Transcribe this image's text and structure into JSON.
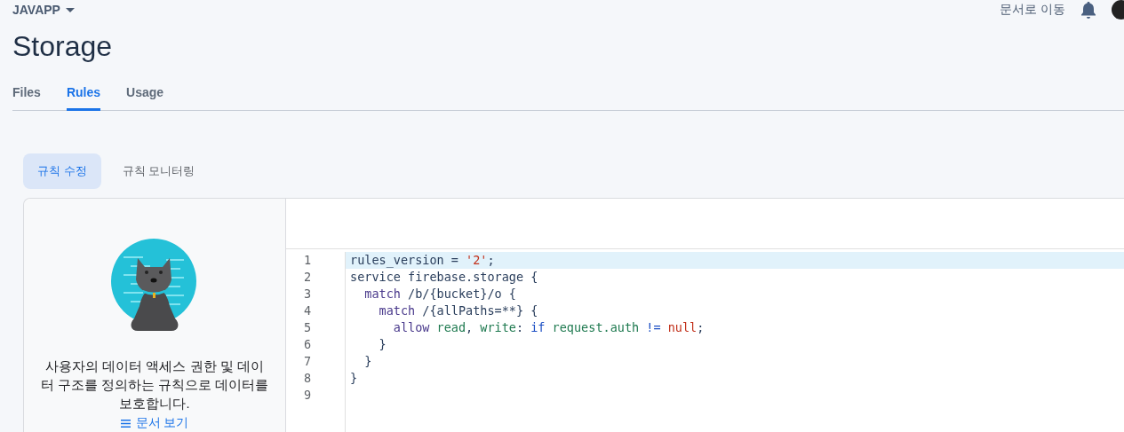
{
  "header": {
    "project": "JAVAPP",
    "docs_link": "문서로 이동"
  },
  "title": "Storage",
  "tabs": [
    {
      "label": "Files",
      "selected": false
    },
    {
      "label": "Rules",
      "selected": true
    },
    {
      "label": "Usage",
      "selected": false
    }
  ],
  "subtabs": [
    {
      "label": "규칙 수정",
      "selected": true
    },
    {
      "label": "규칙 모니터링",
      "selected": false
    }
  ],
  "info_panel": {
    "description": "사용자의 데이터 액세스 권한 및 데이터 구조를 정의하는 규칙으로 데이터를 보호합니다.",
    "docs_link": "문서 보기"
  },
  "editor": {
    "lines": [
      {
        "number": "1",
        "active": true,
        "tokens": [
          {
            "kind": "plain",
            "text": "rules_version = "
          },
          {
            "kind": "literal",
            "text": "'2'"
          },
          {
            "kind": "plain",
            "text": ";"
          }
        ]
      },
      {
        "number": "2",
        "active": false,
        "tokens": [
          {
            "kind": "plain",
            "text": "service firebase.storage {"
          }
        ]
      },
      {
        "number": "3",
        "active": false,
        "tokens": [
          {
            "kind": "keyword",
            "text": "  match"
          },
          {
            "kind": "plain",
            "text": " /b/{bucket}/o {"
          }
        ]
      },
      {
        "number": "4",
        "active": false,
        "tokens": [
          {
            "kind": "keyword",
            "text": "    match"
          },
          {
            "kind": "plain",
            "text": " /{allPaths=**} {"
          }
        ]
      },
      {
        "number": "5",
        "active": false,
        "tokens": [
          {
            "kind": "keyword",
            "text": "      allow"
          },
          {
            "kind": "ident",
            "text": " read"
          },
          {
            "kind": "plain",
            "text": ", "
          },
          {
            "kind": "ident",
            "text": "write"
          },
          {
            "kind": "plain",
            "text": ": "
          },
          {
            "kind": "operator",
            "text": "if"
          },
          {
            "kind": "ident",
            "text": " request.auth"
          },
          {
            "kind": "operator",
            "text": " !="
          },
          {
            "kind": "literal",
            "text": " null"
          },
          {
            "kind": "plain",
            "text": ";"
          }
        ]
      },
      {
        "number": "6",
        "active": false,
        "tokens": [
          {
            "kind": "plain",
            "text": "    }"
          }
        ]
      },
      {
        "number": "7",
        "active": false,
        "tokens": [
          {
            "kind": "plain",
            "text": "  }"
          }
        ]
      },
      {
        "number": "8",
        "active": false,
        "tokens": [
          {
            "kind": "plain",
            "text": "}"
          }
        ]
      },
      {
        "number": "9",
        "active": false
      }
    ]
  }
}
